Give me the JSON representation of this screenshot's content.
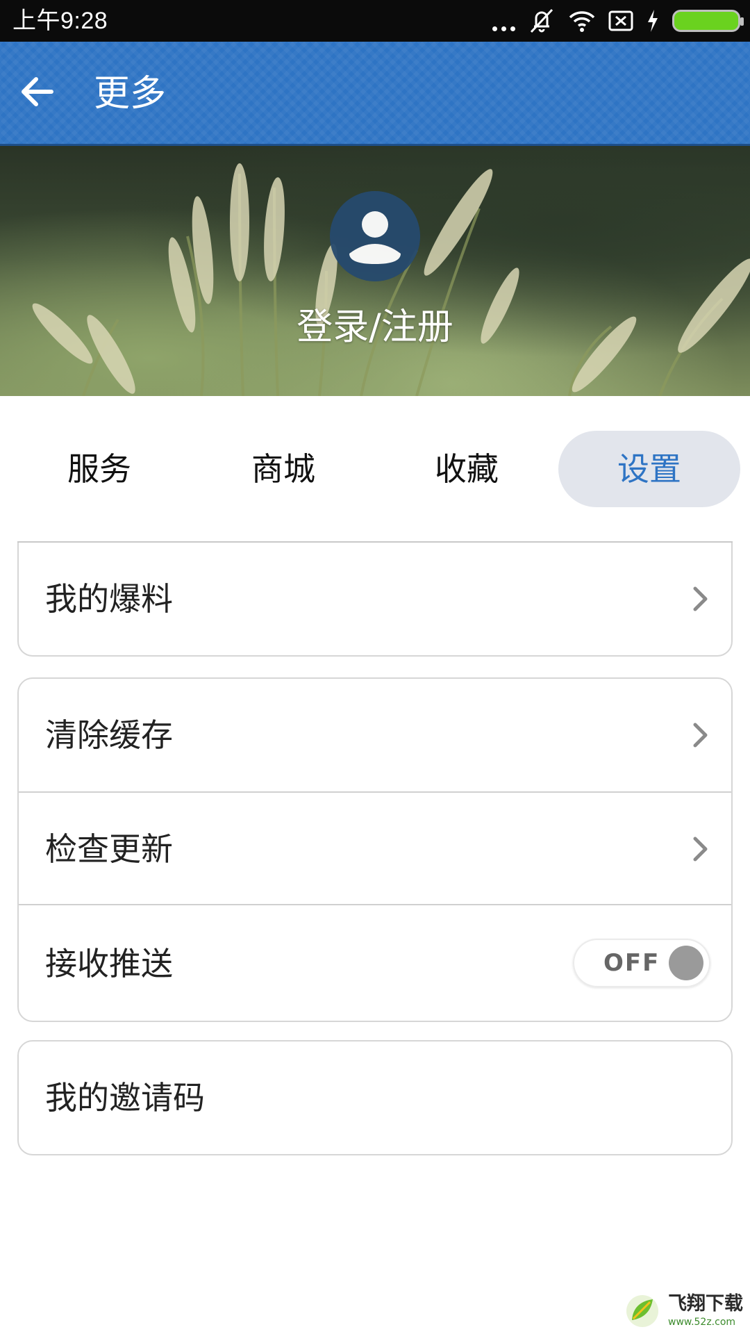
{
  "status_bar": {
    "time": "上午9:28",
    "colors": {
      "battery": "#6ad21f"
    }
  },
  "app_bar": {
    "title": "更多",
    "back_icon": "arrow-left-icon",
    "color": "#2e74c4"
  },
  "profile": {
    "login_label": "登录/注册",
    "avatar_icon": "user-avatar-icon"
  },
  "tabs": [
    {
      "label": "服务",
      "active": false
    },
    {
      "label": "商城",
      "active": false
    },
    {
      "label": "收藏",
      "active": false
    },
    {
      "label": "设置",
      "active": true
    }
  ],
  "settings": {
    "my_tips": {
      "label": "我的爆料",
      "icon": "chevron-right-icon"
    },
    "clear_cache": {
      "label": "清除缓存",
      "icon": "chevron-right-icon"
    },
    "check_update": {
      "label": "检查更新",
      "icon": "chevron-right-icon"
    },
    "push": {
      "label": "接收推送",
      "toggle_text": "OFF",
      "enabled": false
    },
    "invite_code": {
      "label": "我的邀请码"
    }
  },
  "watermark": {
    "name": "飞翔下载",
    "url": "www.52z.com"
  }
}
